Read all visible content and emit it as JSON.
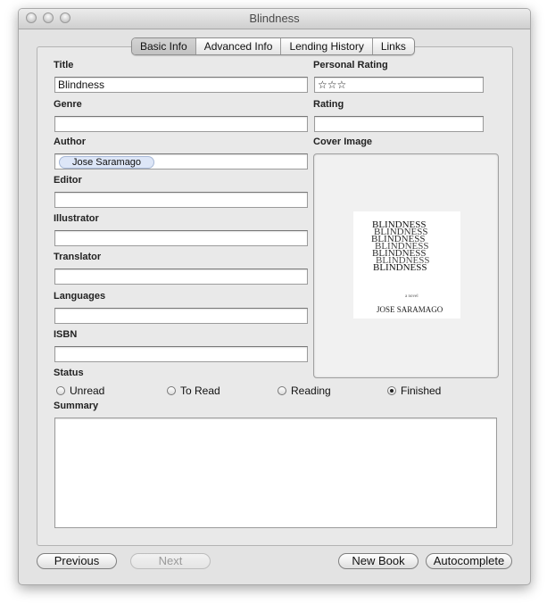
{
  "window": {
    "title": "Blindness"
  },
  "tabs": [
    {
      "label": "Basic Info",
      "selected": true
    },
    {
      "label": "Advanced Info",
      "selected": false
    },
    {
      "label": "Lending History",
      "selected": false
    },
    {
      "label": "Links",
      "selected": false
    }
  ],
  "fields": {
    "title": {
      "label": "Title",
      "value": "Blindness"
    },
    "personal_rating": {
      "label": "Personal Rating",
      "value": "☆☆☆"
    },
    "genre": {
      "label": "Genre",
      "value": ""
    },
    "rating": {
      "label": "Rating",
      "value": ""
    },
    "author": {
      "label": "Author",
      "value": "Jose Saramago"
    },
    "cover_image": {
      "label": "Cover Image"
    },
    "editor": {
      "label": "Editor",
      "value": ""
    },
    "illustrator": {
      "label": "Illustrator",
      "value": ""
    },
    "translator": {
      "label": "Translator",
      "value": ""
    },
    "languages": {
      "label": "Languages",
      "value": ""
    },
    "isbn": {
      "label": "ISBN",
      "value": ""
    },
    "status": {
      "label": "Status",
      "options": [
        "Unread",
        "To Read",
        "Reading",
        "Finished"
      ],
      "selected": "Finished"
    },
    "summary": {
      "label": "Summary",
      "value": ""
    }
  },
  "cover": {
    "title_text": "BLINDNESS",
    "author_text": "JOSE SARAMAGO",
    "small_text": "a novel"
  },
  "buttons": {
    "previous": "Previous",
    "next": "Next",
    "new_book": "New Book",
    "autocomplete": "Autocomplete"
  },
  "icons": {
    "close": "window-close-icon",
    "minimize": "window-minimize-icon",
    "zoom": "window-zoom-icon",
    "stepper": "up-down-stepper-icon"
  }
}
